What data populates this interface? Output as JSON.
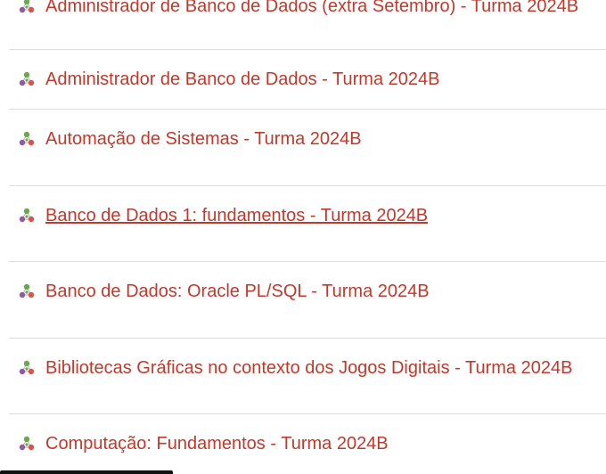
{
  "colors": {
    "link": "#c0392b",
    "icon_green": "#6aa84f",
    "icon_purple": "#8e5aa8",
    "icon_red": "#d9534f",
    "divider": "#dedede"
  },
  "course_icon": "course-network-icon",
  "courses": [
    {
      "label": "Administrador de Banco de Dados (extra Setembro) - Turma 2024B"
    },
    {
      "label": "Administrador de Banco de Dados - Turma 2024B"
    },
    {
      "label": "Automação de Sistemas - Turma 2024B"
    },
    {
      "label": "Banco de Dados 1: fundamentos - Turma 2024B"
    },
    {
      "label": "Banco de Dados: Oracle PL/SQL - Turma 2024B"
    },
    {
      "label": "Bibliotecas Gráficas no contexto dos Jogos Digitais - Turma 2024B"
    },
    {
      "label": "Computação: Fundamentos - Turma 2024B"
    }
  ]
}
